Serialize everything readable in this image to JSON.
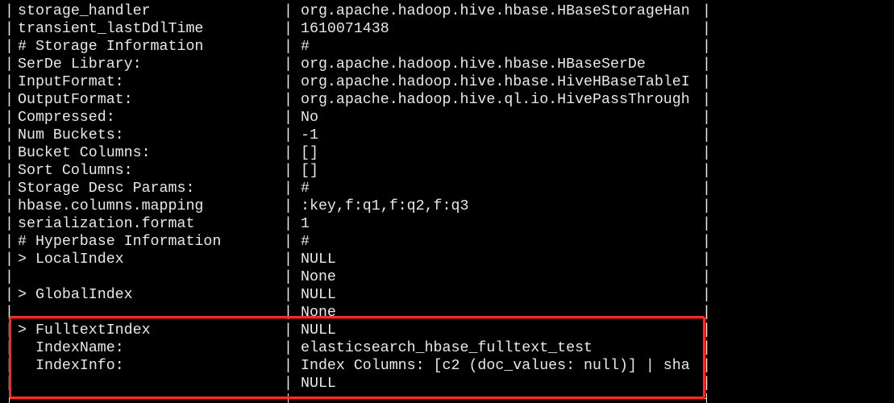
{
  "terminal": {
    "separator": "|",
    "rows": [
      {
        "key": "storage_handler",
        "value": "org.apache.hadoop.hive.hbase.HBaseStorageHan"
      },
      {
        "key": "transient_lastDdlTime",
        "value": "1610071438"
      },
      {
        "key": "# Storage Information",
        "value": "#"
      },
      {
        "key": "SerDe Library:",
        "value": "org.apache.hadoop.hive.hbase.HBaseSerDe"
      },
      {
        "key": "InputFormat:",
        "value": "org.apache.hadoop.hive.hbase.HiveHBaseTableI"
      },
      {
        "key": "OutputFormat:",
        "value": "org.apache.hadoop.hive.ql.io.HivePassThrough"
      },
      {
        "key": "Compressed:",
        "value": "No"
      },
      {
        "key": "Num Buckets:",
        "value": "-1"
      },
      {
        "key": "Bucket Columns:",
        "value": "[]"
      },
      {
        "key": "Sort Columns:",
        "value": "[]"
      },
      {
        "key": "Storage Desc Params:",
        "value": "#"
      },
      {
        "key": "hbase.columns.mapping",
        "value": ":key,f:q1,f:q2,f:q3"
      },
      {
        "key": "serialization.format",
        "value": "1"
      },
      {
        "key": "# Hyperbase Information",
        "value": "#"
      },
      {
        "key": "> LocalIndex",
        "value": "NULL"
      },
      {
        "key": "",
        "value": "None"
      },
      {
        "key": "> GlobalIndex",
        "value": "NULL"
      },
      {
        "key": "",
        "value": "None"
      },
      {
        "key": "> FulltextIndex",
        "value": "NULL"
      },
      {
        "key": "  IndexName:",
        "value": "elasticsearch_hbase_fulltext_test"
      },
      {
        "key": "  IndexInfo:",
        "value": "Index Columns: [c2 (doc_values: null)] | sha"
      },
      {
        "key": "",
        "value": "NULL"
      }
    ],
    "highlight": {
      "label": "fulltext-index-annotation",
      "color": "#ff2a1f",
      "rows_from": 18,
      "rows_to": 21
    },
    "colors": {
      "background": "#000000",
      "text": "#e8e8e8",
      "annotation": "#ff2a1f"
    }
  }
}
